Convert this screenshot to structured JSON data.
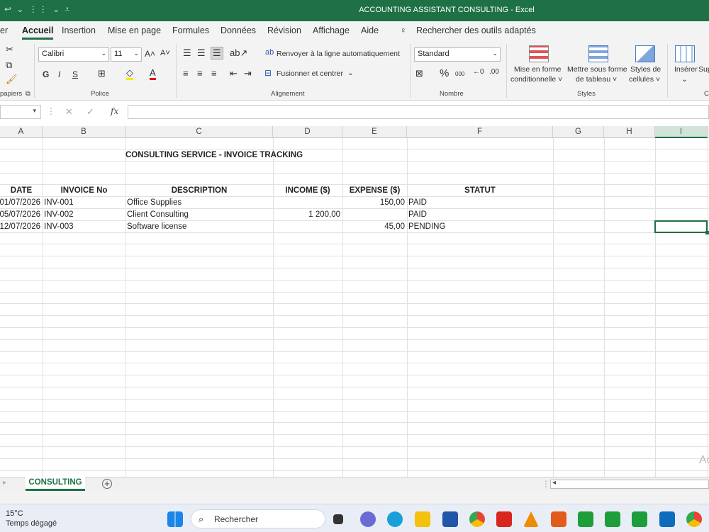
{
  "window": {
    "title": "ACCOUNTING ASSISTANT CONSULTING  -  Excel",
    "quick_access": "↩ ⌄ ⋮⋮ ⌄ ⩡"
  },
  "menu": {
    "tabs": [
      "er",
      "Accueil",
      "Insertion",
      "Mise en page",
      "Formules",
      "Données",
      "Révision",
      "Affichage",
      "Aide"
    ],
    "active": "Accueil",
    "search": "Rechercher des outils adaptés"
  },
  "ribbon": {
    "clipboard_label": "papiers",
    "font_name": "Calibri",
    "font_size": "11",
    "grow": "A˄",
    "shrink": "A˅",
    "bold": "G",
    "italic": "I",
    "underline": "S",
    "police_label": "Police",
    "wrap_text": "Renvoyer à la ligne automatiquement",
    "merge_center": "Fusionner et centrer",
    "alignment_label": "Alignement",
    "number_format": "Standard",
    "percent": "%",
    "thousands": "000",
    "number_label": "Nombre",
    "cond_format_1": "Mise en forme",
    "cond_format_2": "conditionnelle ˅",
    "format_table_1": "Mettre sous forme",
    "format_table_2": "de tableau ˅",
    "cell_styles_1": "Styles de",
    "cell_styles_2": "cellules ˅",
    "styles_label": "Styles",
    "insert": "Insérer",
    "delete": "Sup",
    "cells_label": "C"
  },
  "formula_bar": {
    "fx": "fx",
    "cancel": "✕",
    "confirm": "✓",
    "content": ""
  },
  "columns": [
    "A",
    "B",
    "C",
    "D",
    "E",
    "F",
    "G",
    "H",
    "I"
  ],
  "selected_column": "I",
  "sheet": {
    "title": "CONSULTING SERVICE - INVOICE TRACKING",
    "headers": [
      "DATE",
      "INVOICE No",
      "DESCRIPTION",
      "INCOME ($)",
      "EXPENSE ($)",
      "STATUT"
    ],
    "rows": [
      [
        "01/07/2026",
        "INV-001",
        "Office Supplies",
        "",
        "150,00",
        "PAID"
      ],
      [
        "05/07/2026",
        "INV-002",
        "Client Consulting",
        "1 200,00",
        "",
        "PAID"
      ],
      [
        "12/07/2026",
        "INV-003",
        "Software license",
        "",
        "45,00",
        "PENDING"
      ]
    ]
  },
  "sheet_tabs": {
    "active": "CONSULTING",
    "add": "+"
  },
  "watermark": "Ac",
  "taskbar": {
    "weather_temp": "15°C",
    "weather_desc": "Temps dégagé",
    "search": "Rechercher"
  }
}
